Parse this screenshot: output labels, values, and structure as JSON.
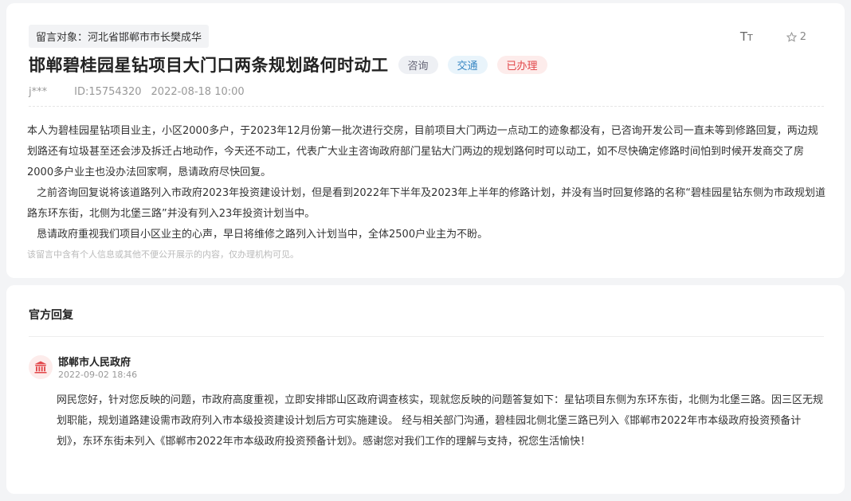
{
  "message": {
    "target": "留言对象：河北省邯郸市市长樊成华",
    "font_icon": "Tт",
    "favorite_count": "2",
    "title": "邯郸碧桂园星钻项目大门口两条规划路何时动工",
    "tags": [
      "咨询",
      "交通",
      "已办理"
    ],
    "author": "j***",
    "id": "ID:15754320",
    "date": "2022-08-18 10:00",
    "paragraphs": [
      "本人为碧桂园星钻项目业主，小区2000多户，于2023年12月份第一批次进行交房，目前项目大门两边一点动工的迹象都没有，已咨询开发公司一直未等到修路回复，两边规划路还有垃圾甚至还会涉及拆迁占地动作，今天还不动工，代表广大业主咨询政府部门星钻大门两边的规划路何时可以动工，如不尽快确定修路时间怕到时候开发商交了房2000多户业主也没办法回家啊，恳请政府尽快回复。",
      "之前咨询回复说将该道路列入市政府2023年投资建设计划，但是看到2022年下半年及2023年上半年的修路计划，并没有当时回复修路的名称“碧桂园星钻东侧为市政规划道路东环东街，北侧为北堡三路”并没有列入23年投资计划当中。",
      "恳请政府重视我们项目小区业主的心声，早日将维修之路列入计划当中，全体2500户业主为不盼。"
    ],
    "notice": "该留言中含有个人信息或其他不便公开展示的内容，仅办理机构可见。"
  },
  "reply": {
    "section_title": "官方回复",
    "org": "邯郸市人民政府",
    "time": "2022-09-02 18:46",
    "content": "网民您好，针对您反映的问题，市政府高度重视，立即安排邯山区政府调查核实，现就您反映的问题答复如下：星钻项目东侧为东环东街，北侧为北堡三路。因三区无规划职能，规划道路建设需市政府列入市本级投资建设计划后方可实施建设。 经与相关部门沟通，碧桂园北侧北堡三路已列入《邯郸市2022年市本级政府投资预备计划》，东环东街未列入《邯郸市2022年市本级政府投资预备计划》。感谢您对我们工作的理解与支持，祝您生活愉快！"
  },
  "colors": {
    "tag_consult": "#667788",
    "tag_traffic": "#3a88c4",
    "tag_done": "#e2474a",
    "gov_logo": "#e2474a"
  },
  "icons": [
    "font-size-icon",
    "star-icon",
    "government-building-icon"
  ]
}
